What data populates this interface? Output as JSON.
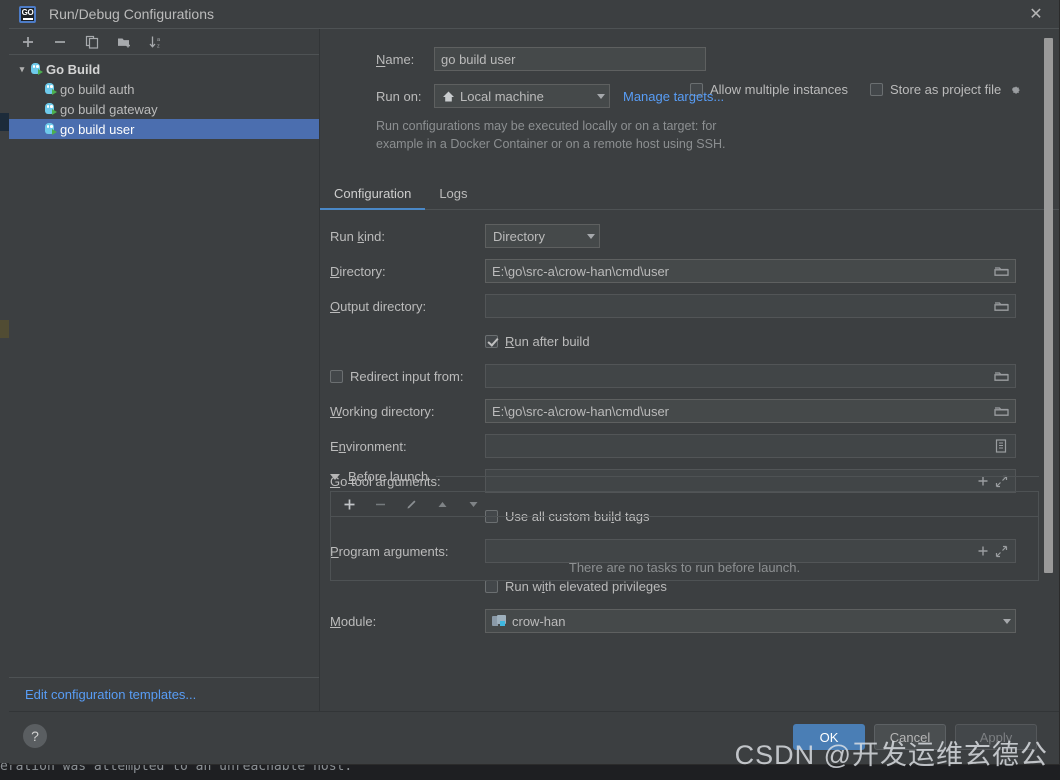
{
  "window": {
    "title": "Run/Debug Configurations",
    "app_icon": "go-logo-icon",
    "close_label": "✕"
  },
  "background": {
    "console_text": "eration was attempted to an unreachable host."
  },
  "left_panel": {
    "toolbar": [
      {
        "name": "add-configuration-button",
        "glyph": "+"
      },
      {
        "name": "remove-configuration-button",
        "glyph": "−"
      },
      {
        "name": "copy-configuration-button",
        "glyph": "copy-icon"
      },
      {
        "name": "add-folder-button",
        "glyph": "folder-add-icon"
      },
      {
        "name": "sort-configurations-button",
        "glyph": "sort-az-icon"
      }
    ],
    "tree": [
      {
        "label": "Go Build",
        "type": "group",
        "expanded": true,
        "selected": false
      },
      {
        "label": "go build auth",
        "type": "item",
        "selected": false
      },
      {
        "label": "go build gateway",
        "type": "item",
        "selected": false
      },
      {
        "label": "go build user",
        "type": "item",
        "selected": true
      }
    ],
    "edit_templates_link": "Edit configuration templates..."
  },
  "header": {
    "name_label": "Name:",
    "name_value": "go build user",
    "allow_multiple_instances": {
      "label": "Allow multiple instances",
      "checked": false
    },
    "store_as_project_file": {
      "label": "Store as project file",
      "checked": false,
      "gear_icon": "gear-icon"
    },
    "run_on_label": "Run on:",
    "run_on_value": "Local machine",
    "manage_targets_link": "Manage targets...",
    "hint_line1": "Run configurations may be executed locally or on a target: for",
    "hint_line2": "example in a Docker Container or on a remote host using SSH."
  },
  "tabs": [
    {
      "label": "Configuration",
      "active": true
    },
    {
      "label": "Logs",
      "active": false
    }
  ],
  "form": {
    "run_kind": {
      "label": "Run kind:",
      "value": "Directory"
    },
    "directory": {
      "label": "Directory:",
      "value": "E:\\go\\src-a\\crow-han\\cmd\\user",
      "icon": "folder-icon"
    },
    "output_directory": {
      "label": "Output directory:",
      "value": "",
      "icon": "folder-icon"
    },
    "run_after_build": {
      "label": "Run after build",
      "checked": true
    },
    "redirect_input_from": {
      "label": "Redirect input from:",
      "checked": false,
      "value": "",
      "icon": "folder-icon"
    },
    "working_directory": {
      "label": "Working directory:",
      "value": "E:\\go\\src-a\\crow-han\\cmd\\user",
      "icon": "folder-icon"
    },
    "environment": {
      "label": "Environment:",
      "value": "",
      "icon": "list-icon"
    },
    "go_tool_arguments": {
      "label": "Go tool arguments:",
      "value": "",
      "icon_add": "plus-icon",
      "icon_expand": "expand-icon"
    },
    "use_all_custom_build_tags": {
      "label": "Use all custom build tags",
      "checked": false
    },
    "program_arguments": {
      "label": "Program arguments:",
      "value": "",
      "icon_add": "plus-icon",
      "icon_expand": "expand-icon"
    },
    "run_with_elevated_privileges": {
      "label": "Run with elevated privileges",
      "checked": false
    },
    "module": {
      "label": "Module:",
      "value": "crow-han",
      "icon": "module-icon"
    }
  },
  "before_launch": {
    "title": "Before launch",
    "expanded": true,
    "toolbar": [
      {
        "name": "add-task-button",
        "glyph": "+"
      },
      {
        "name": "remove-task-button",
        "glyph": "−"
      },
      {
        "name": "edit-task-button",
        "glyph": "pencil-icon"
      },
      {
        "name": "move-task-up-button",
        "glyph": "triangle-up-icon"
      },
      {
        "name": "move-task-down-button",
        "glyph": "triangle-down-icon"
      }
    ],
    "empty_text": "There are no tasks to run before launch."
  },
  "footer": {
    "help_label": "?",
    "ok_label": "OK",
    "cancel_label": "Cancel",
    "apply_label": "Apply"
  },
  "watermark": {
    "text": "CSDN @开发运维玄德公"
  },
  "colors": {
    "accent": "#4a88c7",
    "selection": "#4b6eaf",
    "link": "#589df6",
    "panel": "#3c3f41",
    "field": "#45494a",
    "ok_button": "#4a7eb5"
  }
}
